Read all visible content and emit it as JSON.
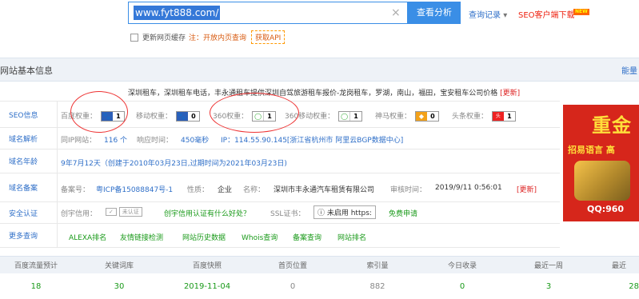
{
  "search": {
    "value": "www.fyt888.com/",
    "clear_icon": "×",
    "submit_label": "查看分析",
    "history_label": "查询记录",
    "history_caret": "▾",
    "seo_download_label": "SEO客户端下载",
    "new_badge": "NEW"
  },
  "options": {
    "refresh_cache_label": "更新网页缓存",
    "note_label": "注：",
    "note_text": "开放内页查询",
    "api_label": "获取API"
  },
  "section": {
    "title": "网站基本信息",
    "right_link": "能量"
  },
  "site_description": {
    "text": "深圳租车，深圳租车电话，丰永通租车提供深圳自驾旅游租车报价-龙岗租车，罗湖，南山，福田，宝安租车公司价格",
    "update_label": "[更新]"
  },
  "seo_row": {
    "label": "SEO信息",
    "items": [
      {
        "label": "百度权重：",
        "icon": "paw-icon",
        "value": "1"
      },
      {
        "label": "移动权重：",
        "icon": "paw-icon",
        "value": "0"
      },
      {
        "label": "360权重：",
        "icon": "360-icon",
        "value": "1"
      },
      {
        "label": "360移动权重：",
        "icon": "360-icon",
        "value": "1"
      },
      {
        "label": "神马权重：",
        "icon": "shenma-icon",
        "value": "0"
      },
      {
        "label": "头条权重：",
        "icon": "toutiao-icon",
        "value": "1"
      }
    ]
  },
  "dns_row": {
    "label": "域名解析",
    "same_ip_label": "同IP网站：",
    "same_ip_value": "116 个",
    "response_label": "响应时间：",
    "response_value": "450毫秒",
    "ip_text": "IP：114.55.90.145[浙江省杭州市 阿里云BGP数据中心]"
  },
  "age_row": {
    "label": "域名年龄",
    "text": "9年7月12天（创建于2010年03月23日,过期时间为2021年03月23日)"
  },
  "icp_row": {
    "label": "域名备案",
    "number_label": "备案号：",
    "number_value": "粤ICP备15088847号-1",
    "nature_label": "性质：",
    "nature_value": "企业",
    "name_label": "名称：",
    "name_value": "深圳市丰永通汽车租赁有限公司",
    "audit_label": "审核时间：",
    "audit_value": "2019/9/11 0:56:01",
    "update_label": "[更新]"
  },
  "security_row": {
    "label": "安全认证",
    "credit_label": "创宇信用：",
    "credit_badge": "未认证",
    "credit_question": "创宇信用认证有什么好处？",
    "ssl_label": "SSL证书：",
    "ssl_value": "ⓘ 未启用 https:",
    "free_apply": "免费申请"
  },
  "more_row": {
    "label": "更多查询",
    "links": [
      "ALEXA排名",
      "友情链接检测",
      "网站历史数据",
      "Whois查询",
      "备案查询",
      "网站排名"
    ]
  },
  "ad": {
    "title": "重金",
    "subtitle": "招易语言 高",
    "qq": "QQ:960"
  },
  "stats": {
    "headers": [
      "百度流量预计",
      "关键词库",
      "百度快照",
      "首页位置",
      "索引量",
      "今日收录",
      "最近一周",
      "最近"
    ],
    "values": [
      "18",
      "30",
      "2019-11-04",
      "0",
      "882",
      "0",
      "3",
      "28"
    ],
    "value_colors": [
      "#1a9a1a",
      "#1a9a1a",
      "#1a9a1a",
      "#888888",
      "#888888",
      "#1a9a1a",
      "#1a9a1a",
      "#1a9a1a"
    ]
  }
}
